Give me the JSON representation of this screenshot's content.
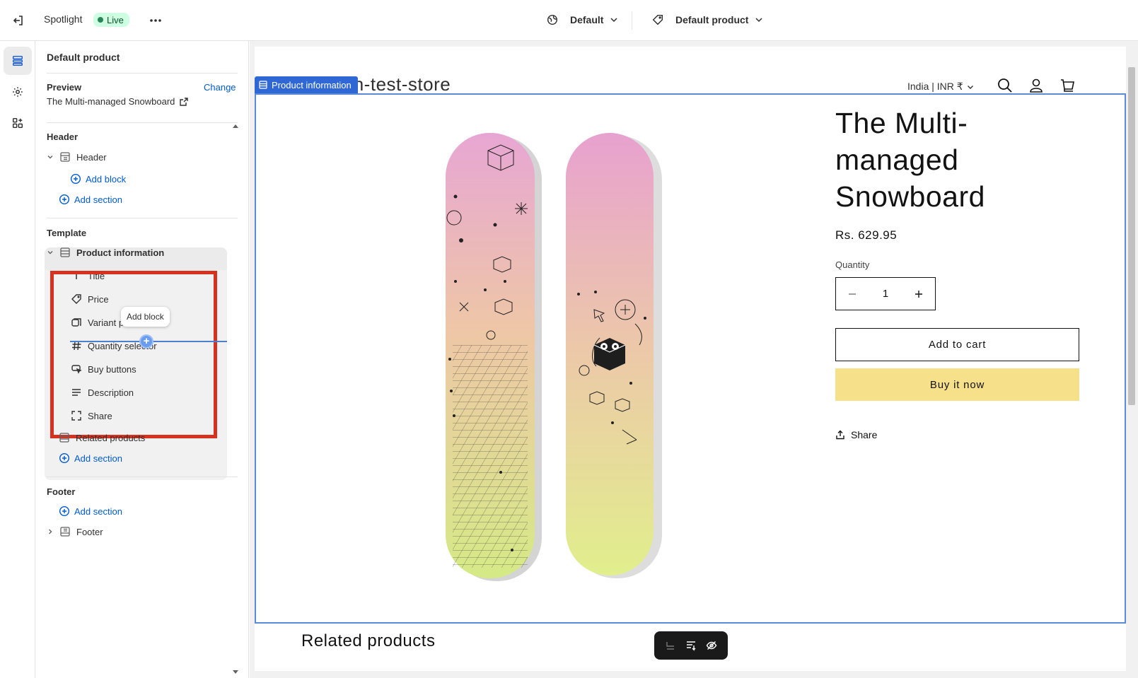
{
  "topbar": {
    "app_name": "Spotlight",
    "status_badge": "Live",
    "theme_selector": "Default",
    "template_selector": "Default product",
    "icons": [
      "exit-icon",
      "more-icon",
      "globe-icon",
      "tag-icon",
      "chevron-down-icon"
    ]
  },
  "iconbar": {
    "items": [
      "sections-icon",
      "settings-icon",
      "apps-icon"
    ]
  },
  "sidebar": {
    "title": "Default product",
    "preview": {
      "label": "Preview",
      "change_link": "Change",
      "product": "The Multi-managed Snowboard"
    },
    "header_group": {
      "label": "Header",
      "section": "Header",
      "add_block": "Add block",
      "add_section": "Add section"
    },
    "template_group": {
      "label": "Template",
      "section": "Product information",
      "blocks": [
        "Title",
        "Price",
        "Variant picker",
        "Quantity selector",
        "Buy buttons",
        "Description",
        "Share"
      ],
      "tooltip": "Add block",
      "related": "Related products",
      "add_section": "Add section"
    },
    "footer_group": {
      "label": "Footer",
      "add_section": "Add section",
      "section": "Footer"
    }
  },
  "preview": {
    "section_tag": "Product information",
    "store_name": "th-test-store",
    "country_selector": "India | INR ₹",
    "product_title": "The Multi-managed Snowboard",
    "price": "Rs. 629.95",
    "quantity_label": "Quantity",
    "quantity_value": "1",
    "add_to_cart": "Add to cart",
    "buy_now": "Buy it now",
    "share": "Share",
    "related_heading": "Related products",
    "colors": {
      "buy_button": "#f6e08a",
      "outline": "#5a8ad9",
      "tag": "#2f68d5",
      "highlight": "#d6321f"
    }
  }
}
